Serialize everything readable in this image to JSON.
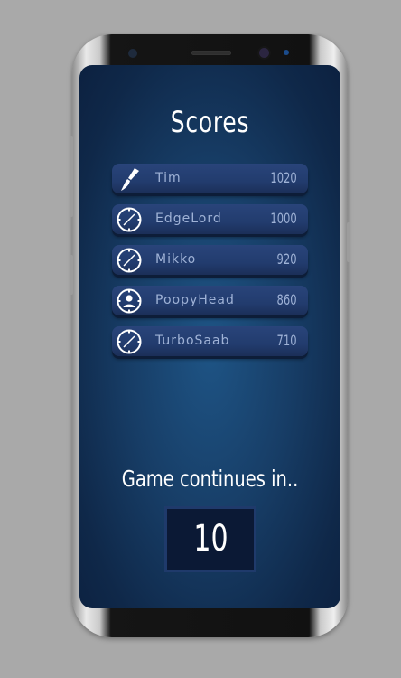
{
  "screen": {
    "title": "Scores",
    "continues_label": "Game continues in..",
    "countdown": "10"
  },
  "scores": [
    {
      "name": "Tim",
      "score": "1020",
      "icon": "brush-icon"
    },
    {
      "name": "EdgeLord",
      "score": "1000",
      "icon": "compass-icon"
    },
    {
      "name": "Mikko",
      "score": "920",
      "icon": "compass-icon"
    },
    {
      "name": "PoopyHead",
      "score": "860",
      "icon": "user-icon"
    },
    {
      "name": "TurboSaab",
      "score": "710",
      "icon": "compass-icon"
    }
  ],
  "colors": {
    "background": "#a9a9a9",
    "screen": "#173d66",
    "row": "#223c6e",
    "row_text": "#9fb2d6",
    "title_text": "#ffffff"
  }
}
